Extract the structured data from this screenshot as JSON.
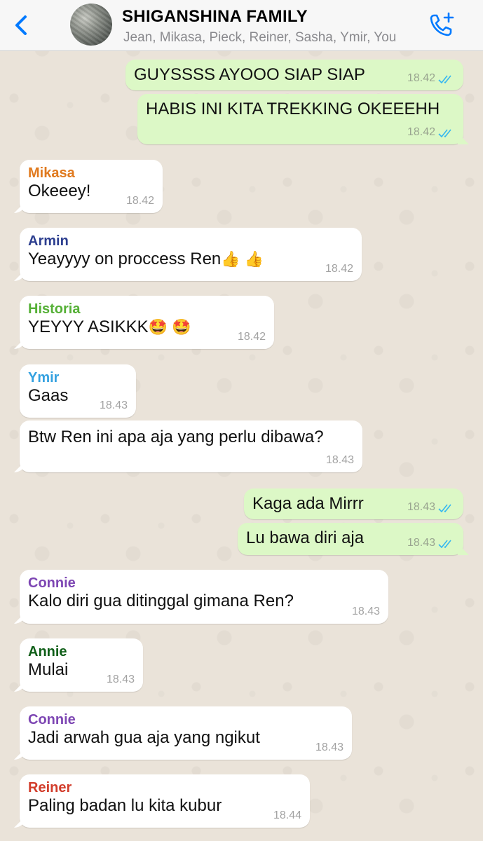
{
  "header": {
    "title": "SHIGANSHINA FAMILY",
    "members": "Jean, Mikasa, Pieck, Reiner, Sasha, Ymir, You",
    "back_icon": "chevron-left-icon",
    "call_icon": "add-call-icon",
    "accent": "#007AFF"
  },
  "colors": {
    "incoming_bubble": "#FFFFFF",
    "outgoing_bubble": "#DCF8C6",
    "read_ticks": "#34B7F1",
    "senders": {
      "Mikasa": "#E07A1F",
      "Armin": "#2C3E8F",
      "Historia": "#55B036",
      "Ymir": "#34A1E0",
      "Connie": "#7D46B3",
      "Annie": "#0E5E17",
      "Reiner": "#D23C2A"
    }
  },
  "messages": [
    {
      "dir": "out",
      "text": "GUYSSSS AYOOO SIAP SIAP",
      "time": "18.42"
    },
    {
      "dir": "out",
      "text": "HABIS INI KITA TREKKING OKEEEHH",
      "time": "18.42"
    },
    {
      "dir": "in",
      "sender": "Mikasa",
      "text": "Okeeey!",
      "time": "18.42"
    },
    {
      "dir": "in",
      "sender": "Armin",
      "text": "Yeayyyy on proccess Ren",
      "emoji": "👍 👍",
      "time": "18.42"
    },
    {
      "dir": "in",
      "sender": "Historia",
      "text": "YEYYY ASIKKK",
      "emoji": "🤩 🤩",
      "time": "18.42"
    },
    {
      "dir": "in",
      "sender": "Ymir",
      "text": "Gaas",
      "time": "18.43"
    },
    {
      "dir": "in",
      "text": "Btw Ren ini apa aja yang perlu dibawa?",
      "time": "18.43"
    },
    {
      "dir": "out",
      "text": "Kaga ada Mirrr",
      "time": "18.43"
    },
    {
      "dir": "out",
      "text": "Lu bawa diri aja",
      "time": "18.43"
    },
    {
      "dir": "in",
      "sender": "Connie",
      "text": "Kalo diri gua ditinggal gimana Ren?",
      "time": "18.43"
    },
    {
      "dir": "in",
      "sender": "Annie",
      "text": "Mulai",
      "time": "18.43"
    },
    {
      "dir": "in",
      "sender": "Connie",
      "text": "Jadi arwah gua aja yang ngikut",
      "time": "18.43"
    },
    {
      "dir": "in",
      "sender": "Reiner",
      "text": "Paling badan lu kita kubur",
      "time": "18.44"
    }
  ]
}
